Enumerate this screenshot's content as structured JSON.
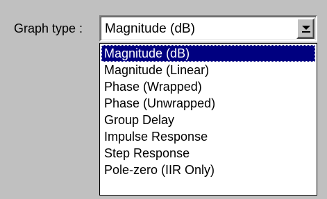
{
  "graph_type": {
    "label": "Graph type :",
    "selected_value": "Magnitude (dB)",
    "options": [
      "Magnitude (dB)",
      "Magnitude (Linear)",
      "Phase (Wrapped)",
      "Phase (Unwrapped)",
      "Group Delay",
      "Impulse Response",
      "Step Response",
      "Pole-zero (IIR Only)"
    ],
    "highlighted_index": 0
  },
  "colors": {
    "dialog_background": "#c0c0c0",
    "highlight": "#000080"
  }
}
